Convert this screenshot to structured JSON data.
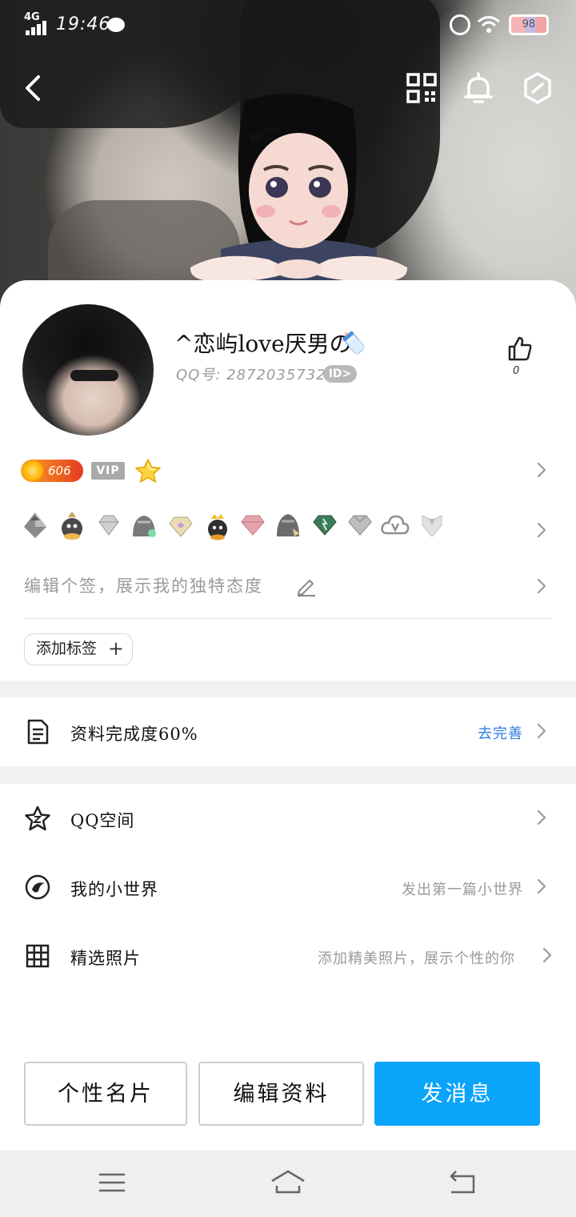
{
  "status_bar": {
    "network": "4G",
    "time": "19:46",
    "battery": "98"
  },
  "header": {
    "icons": [
      "back-arrow-icon",
      "qr-code-icon",
      "bell-icon",
      "settings-hexagon-icon"
    ]
  },
  "profile": {
    "nickname": "^恋屿love厌男の",
    "qq_number": "QQ号: 2872035732",
    "id_badge": "ID>",
    "like_count": "0",
    "level": "606",
    "vip_label": "VIP",
    "signature_placeholder": "编辑个签，展示我的独特态度",
    "add_tag_label": "添加标签"
  },
  "completion": {
    "label": "资料完成度60%",
    "action": "去完善"
  },
  "list": [
    {
      "label": "QQ空间",
      "hint": ""
    },
    {
      "label": "我的小世界",
      "hint": "发出第一篇小世界"
    },
    {
      "label": "精选照片",
      "hint": "添加精美照片，展示个性的你"
    }
  ],
  "buttons": {
    "profile_card": "个性名片",
    "edit_profile": "编辑资料",
    "send_message": "发消息"
  },
  "colors": {
    "accent_blue": "#0aa4fb",
    "link_blue": "#2d7de0",
    "level_badge": "#f27a22"
  }
}
